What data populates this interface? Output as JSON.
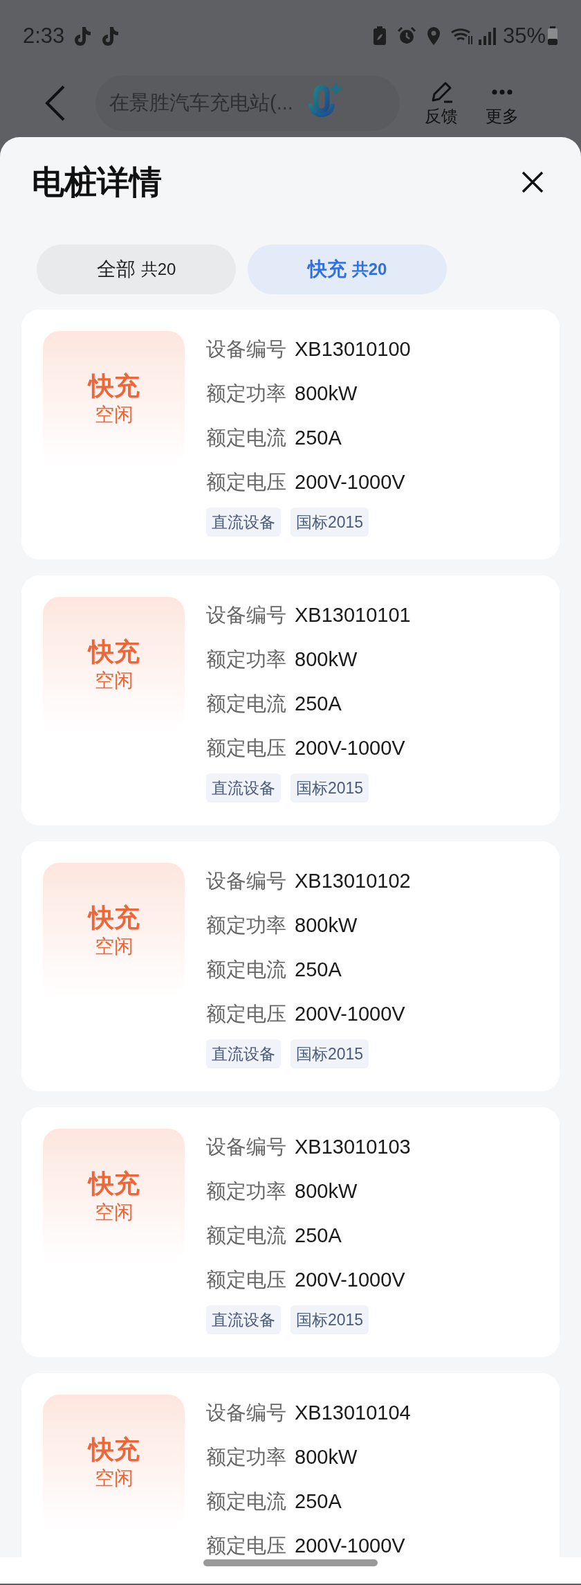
{
  "status_bar": {
    "time": "2:33",
    "battery": "35%"
  },
  "header": {
    "search": {
      "value": "在景胜汽车充电站(..."
    },
    "actions": [
      {
        "kind": "feedback",
        "label": "反馈"
      },
      {
        "kind": "more",
        "label": "更多"
      }
    ]
  },
  "sheet": {
    "title": "电桩详情",
    "tabs": [
      {
        "label": "全部",
        "count": "共20",
        "selected": false
      },
      {
        "label": "快充",
        "count": "共20",
        "selected": true
      }
    ],
    "chargers": [
      {
        "type": "快充",
        "status": "空闲",
        "fields": [
          {
            "label": "设备编号",
            "value": "XB13010100"
          },
          {
            "label": "额定功率",
            "value": "800kW"
          },
          {
            "label": "额定电流",
            "value": "250A"
          },
          {
            "label": "额定电压",
            "value": "200V-1000V"
          }
        ],
        "tags": [
          "直流设备",
          "国标2015"
        ]
      },
      {
        "type": "快充",
        "status": "空闲",
        "fields": [
          {
            "label": "设备编号",
            "value": "XB13010101"
          },
          {
            "label": "额定功率",
            "value": "800kW"
          },
          {
            "label": "额定电流",
            "value": "250A"
          },
          {
            "label": "额定电压",
            "value": "200V-1000V"
          }
        ],
        "tags": [
          "直流设备",
          "国标2015"
        ]
      },
      {
        "type": "快充",
        "status": "空闲",
        "fields": [
          {
            "label": "设备编号",
            "value": "XB13010102"
          },
          {
            "label": "额定功率",
            "value": "800kW"
          },
          {
            "label": "额定电流",
            "value": "250A"
          },
          {
            "label": "额定电压",
            "value": "200V-1000V"
          }
        ],
        "tags": [
          "直流设备",
          "国标2015"
        ]
      },
      {
        "type": "快充",
        "status": "空闲",
        "fields": [
          {
            "label": "设备编号",
            "value": "XB13010103"
          },
          {
            "label": "额定功率",
            "value": "800kW"
          },
          {
            "label": "额定电流",
            "value": "250A"
          },
          {
            "label": "额定电压",
            "value": "200V-1000V"
          }
        ],
        "tags": [
          "直流设备",
          "国标2015"
        ]
      },
      {
        "type": "快充",
        "status": "空闲",
        "fields": [
          {
            "label": "设备编号",
            "value": "XB13010104"
          },
          {
            "label": "额定功率",
            "value": "800kW"
          },
          {
            "label": "额定电流",
            "value": "250A"
          },
          {
            "label": "额定电压",
            "value": "200V-1000V"
          }
        ]
      }
    ]
  }
}
